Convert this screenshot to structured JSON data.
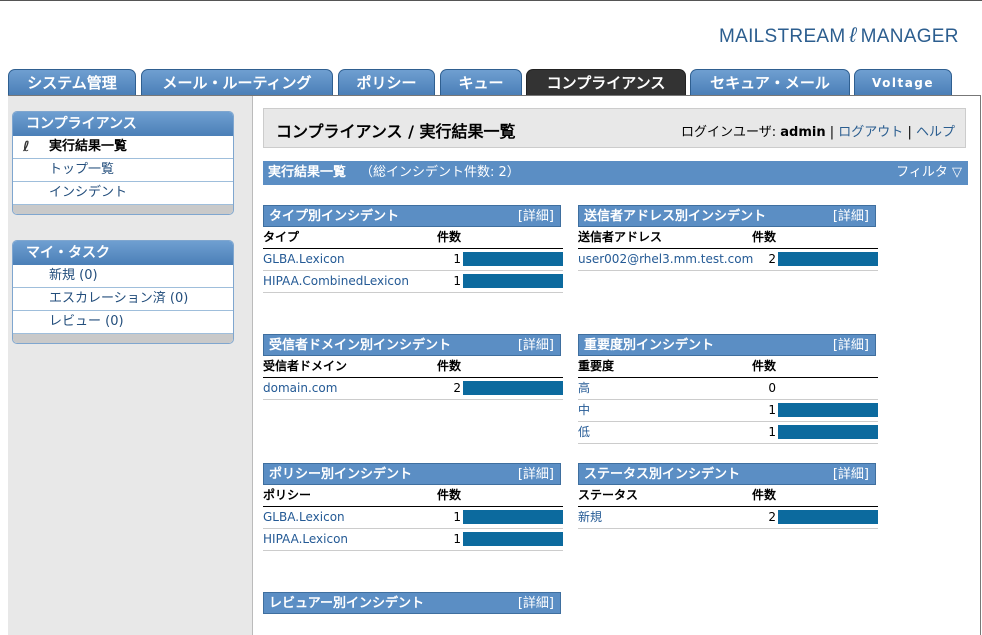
{
  "brand": {
    "left": "MAILSTREAM",
    "icon": "swirl-logo-icon",
    "right": "MANAGER"
  },
  "tabs": [
    "システム管理",
    "メール・ルーティング",
    "ポリシー",
    "キュー",
    "コンプライアンス",
    "セキュア・メール",
    "Voltage"
  ],
  "active_tab": "コンプライアンス",
  "sidebar": {
    "compliance": {
      "title": "コンプライアンス",
      "items": [
        "実行結果一覧",
        "トップ一覧",
        "インシデント"
      ]
    },
    "tasks": {
      "title": "マイ・タスク",
      "items": [
        "新規 (0)",
        "エスカレーション済 (0)",
        "レビュー (0)"
      ]
    }
  },
  "page": {
    "title": "コンプライアンス / 実行結果一覧",
    "login_label": "ログインユーザ:",
    "user": "admin",
    "logout": "ログアウト",
    "help": "ヘルプ",
    "sep": "|"
  },
  "section": {
    "title": "実行結果一覧",
    "count": "（総インシデント件数: 2）",
    "filter": "フィルタ"
  },
  "panels": {
    "type": {
      "title": "タイプ別インシデント",
      "detail": "[詳細]",
      "col1": "タイプ",
      "col2": "件数",
      "rows": [
        {
          "label": "GLBA.Lexicon",
          "count": "1",
          "fraction": 1
        },
        {
          "label": "HIPAA.CombinedLexicon",
          "count": "1",
          "fraction": 1
        }
      ]
    },
    "sender": {
      "title": "送信者アドレス別インシデント",
      "detail": "[詳細]",
      "col1": "送信者アドレス",
      "col2": "件数",
      "rows": [
        {
          "label": "user002@rhel3.mm.test.com",
          "count": "2",
          "fraction": 1
        }
      ]
    },
    "domain": {
      "title": "受信者ドメイン別インシデント",
      "detail": "[詳細]",
      "col1": "受信者ドメイン",
      "col2": "件数",
      "rows": [
        {
          "label": "domain.com",
          "count": "2",
          "fraction": 1
        }
      ]
    },
    "severity": {
      "title": "重要度別インシデント",
      "detail": "[詳細]",
      "col1": "重要度",
      "col2": "件数",
      "rows": [
        {
          "label": "高",
          "count": "0",
          "fraction": 0
        },
        {
          "label": "中",
          "count": "1",
          "fraction": 1
        },
        {
          "label": "低",
          "count": "1",
          "fraction": 1
        }
      ]
    },
    "policy": {
      "title": "ポリシー別インシデント",
      "detail": "[詳細]",
      "col1": "ポリシー",
      "col2": "件数",
      "rows": [
        {
          "label": "GLBA.Lexicon",
          "count": "1",
          "fraction": 1
        },
        {
          "label": "HIPAA.Lexicon",
          "count": "1",
          "fraction": 1
        }
      ]
    },
    "status": {
      "title": "ステータス別インシデント",
      "detail": "[詳細]",
      "col1": "ステータス",
      "col2": "件数",
      "rows": [
        {
          "label": "新規",
          "count": "2",
          "fraction": 1
        }
      ]
    },
    "reviewer": {
      "title": "レビュアー別インシデント",
      "detail": "[詳細]"
    }
  },
  "colors": {
    "accent": "#5b8ec4",
    "bar": "#0c6a9e",
    "tab_active": "#333333",
    "link": "#245a95"
  }
}
